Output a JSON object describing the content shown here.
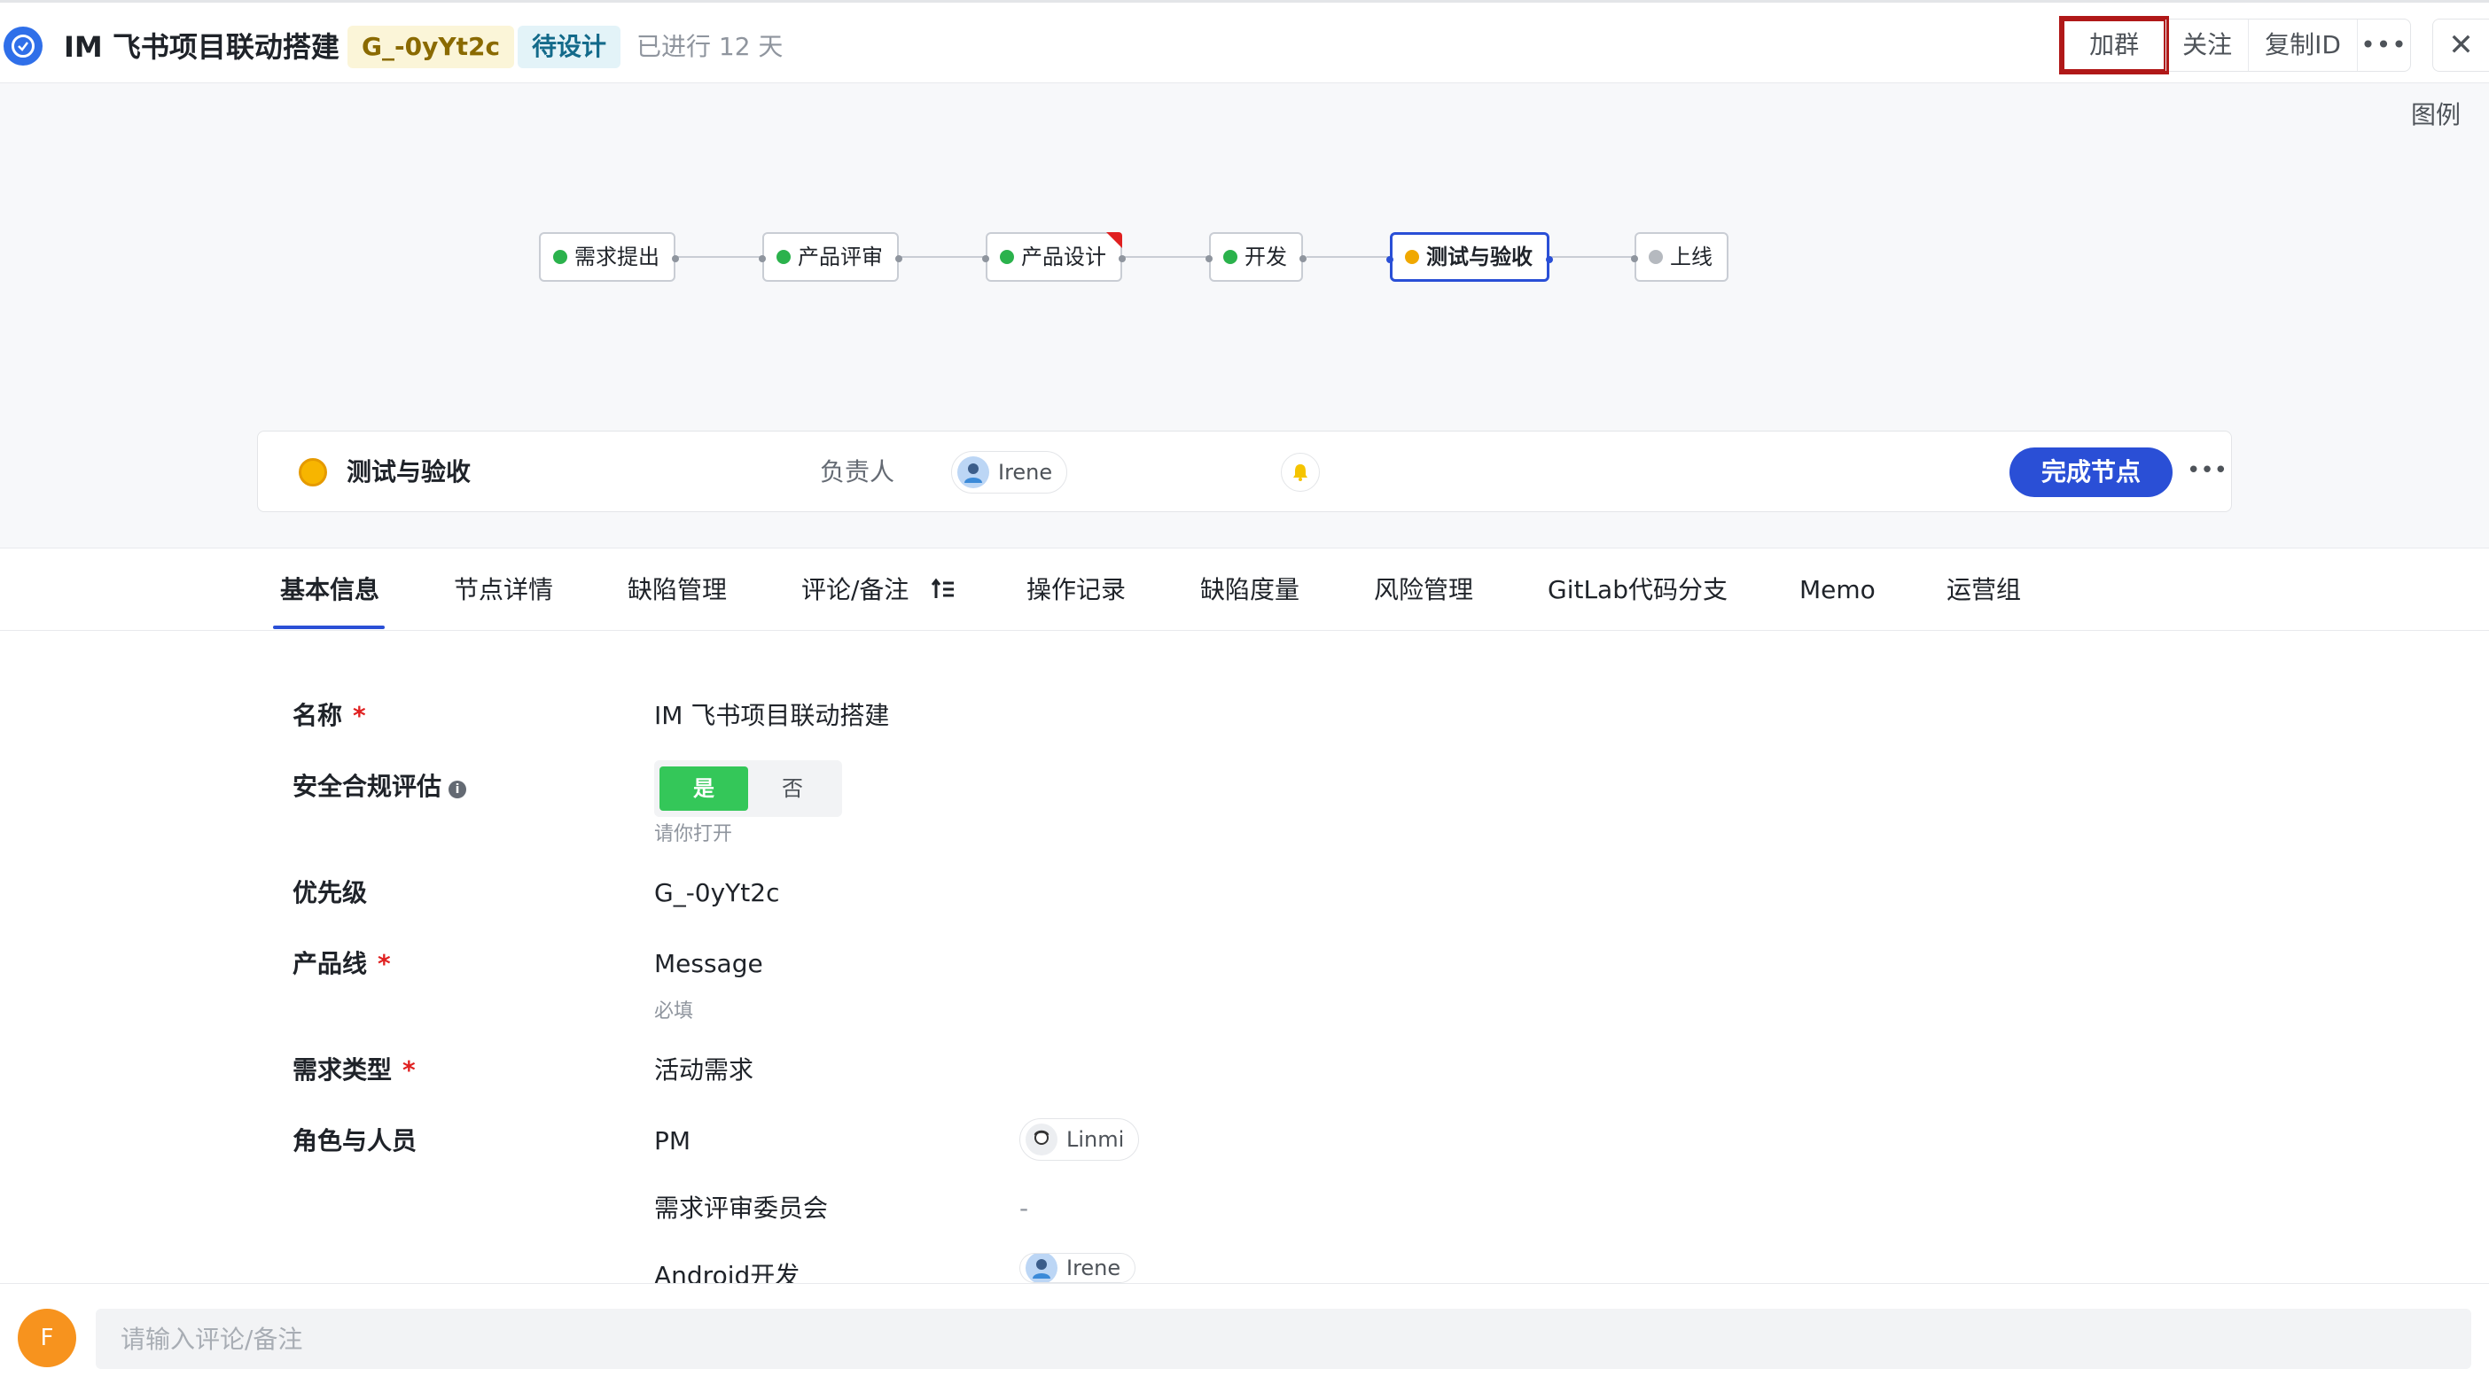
{
  "header": {
    "title": "IM 飞书项目联动搭建",
    "id_tag": "G_-0yYt2c",
    "status_tag": "待设计",
    "elapsed": "已进行 12 天",
    "actions": {
      "join_group": "加群",
      "follow": "关注",
      "copy_id": "复制ID",
      "more": "•••",
      "close": "✕"
    }
  },
  "flow": {
    "legend": "图例",
    "nodes": [
      {
        "label": "需求提出",
        "status_color": "#2bb24c"
      },
      {
        "label": "产品评审",
        "status_color": "#2bb24c"
      },
      {
        "label": "产品设计",
        "status_color": "#2bb24c"
      },
      {
        "label": "开发",
        "status_color": "#2bb24c"
      },
      {
        "label": "测试与验收",
        "status_color": "#f0a800"
      },
      {
        "label": "上线",
        "status_color": "#b5b9bf"
      }
    ]
  },
  "node_card": {
    "name": "测试与验收",
    "owner_label": "负责人",
    "owner_name": "Irene",
    "complete_button": "完成节点",
    "more": "•••"
  },
  "tabs": [
    "基本信息",
    "节点详情",
    "缺陷管理",
    "评论/备注",
    "操作记录",
    "缺陷度量",
    "风险管理",
    "GitLab代码分支",
    "Memo",
    "运营组"
  ],
  "form": {
    "name_label": "名称",
    "name_value": "IM 飞书项目联动搭建",
    "security_label": "安全合规评估",
    "security_yes": "是",
    "security_no": "否",
    "security_hint": "请你打开",
    "priority_label": "优先级",
    "priority_value": "G_-0yYt2c",
    "product_line_label": "产品线",
    "product_line_value": "Message",
    "product_line_hint": "必填",
    "req_type_label": "需求类型",
    "req_type_value": "活动需求",
    "roles_label": "角色与人员",
    "roles": [
      {
        "role": "PM",
        "person": "Linmi"
      },
      {
        "role": "需求评审委员会",
        "person": "-"
      },
      {
        "role": "Android开发",
        "person": "Irene"
      }
    ],
    "required_mark": "*",
    "info_mark": "i"
  },
  "comment": {
    "avatar_letter": "F",
    "placeholder": "请输入评论/备注"
  },
  "colors": {
    "accent": "#2a4fd6",
    "highlight_box": "#b01818",
    "toggle_on": "#34c759"
  }
}
